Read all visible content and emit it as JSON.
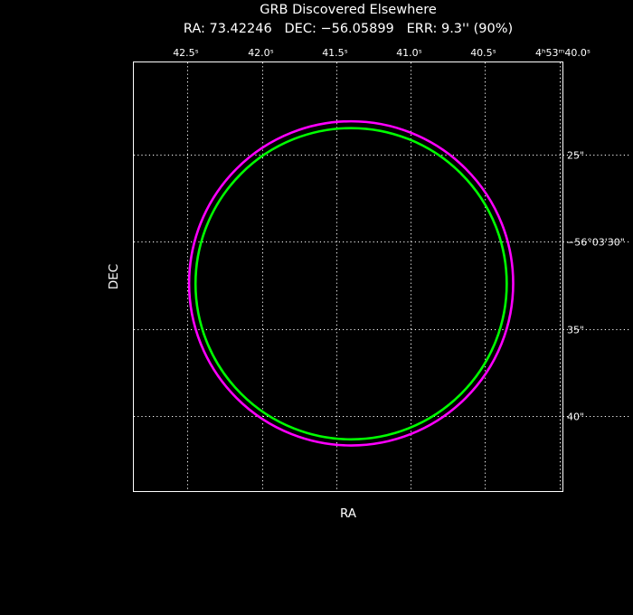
{
  "title": "GRB Discovered Elsewhere",
  "subtitle": "RA: 73.42246   DEC: −56.05899   ERR: 9.3'' (90%)",
  "chart_data": {
    "type": "scatter",
    "xlabel": "RA",
    "ylabel": "DEC",
    "x_unit": "seconds of RA (4h53m)",
    "y_unit": "arcseconds of Dec (−56°03')",
    "x_ticks": [
      {
        "value": 42.5,
        "label": "42.5ˢ"
      },
      {
        "value": 42.0,
        "label": "42.0ˢ"
      },
      {
        "value": 41.5,
        "label": "41.5ˢ"
      },
      {
        "value": 41.0,
        "label": "41.0ˢ"
      },
      {
        "value": 40.5,
        "label": "40.5ˢ"
      },
      {
        "value": 40.0,
        "label": "4ʰ53ᵐ40.0ˢ"
      }
    ],
    "y_ticks": [
      {
        "value": 25,
        "label": "25\""
      },
      {
        "value": 30,
        "label": "−56°03'30\""
      },
      {
        "value": 35,
        "label": "35\""
      },
      {
        "value": 40,
        "label": "40\""
      }
    ],
    "xlim": [
      42.86,
      39.98
    ],
    "ylim": [
      19.7,
      44.3
    ],
    "x_reversed": true,
    "y_reversed": true,
    "grid": true,
    "series": [
      {
        "color": "#ff00ff",
        "center": [
          41.4,
          32.38
        ],
        "radius_arcsec": 9.3
      },
      {
        "color": "#00ff00",
        "center": [
          41.4,
          32.4
        ],
        "radius_arcsec": 8.93
      }
    ]
  }
}
